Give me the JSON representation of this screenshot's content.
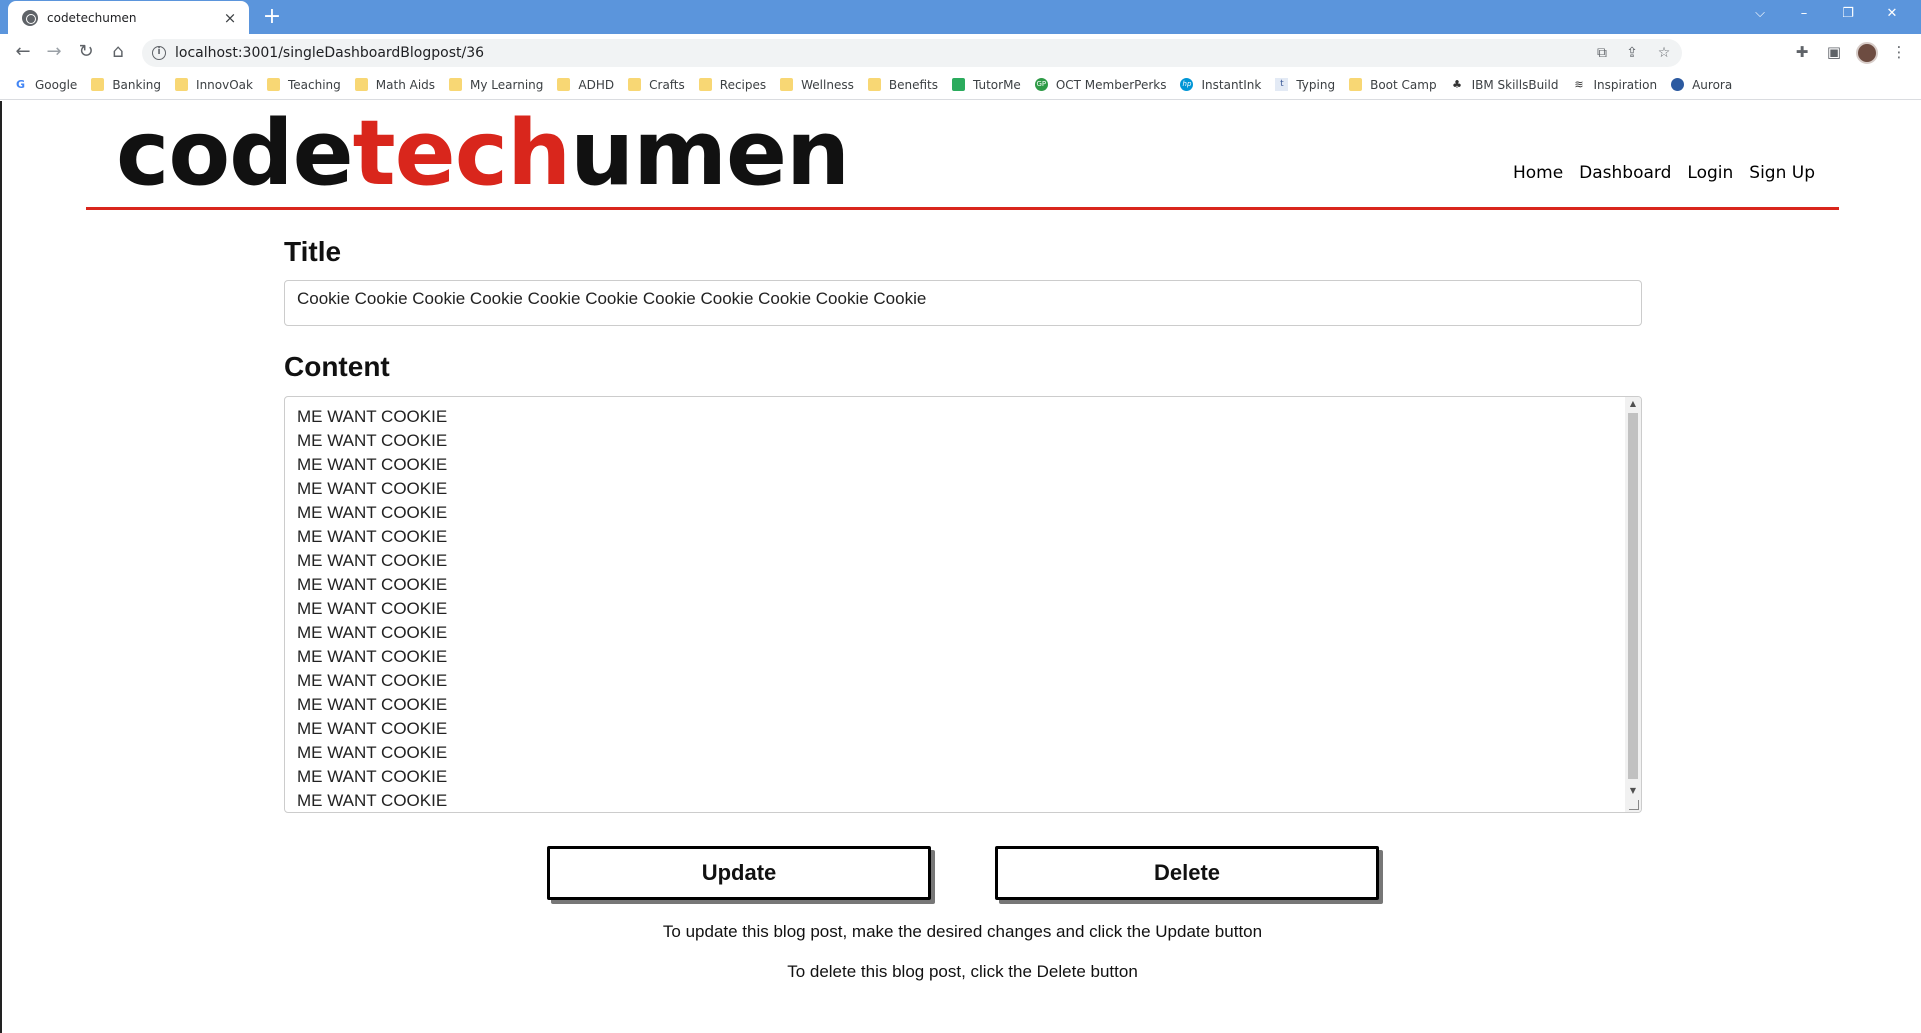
{
  "browser": {
    "tab_title": "codetechumen",
    "tab_close": "×",
    "new_tab": "+",
    "url": "localhost:3001/singleDashboardBlogpost/36",
    "window_controls": [
      "⌵",
      "–",
      "❐",
      "✕"
    ],
    "bookmarks": [
      {
        "label": "Google",
        "icon": "google-icon"
      },
      {
        "label": "Banking",
        "icon": "folder-icon"
      },
      {
        "label": "InnovOak",
        "icon": "folder-icon"
      },
      {
        "label": "Teaching",
        "icon": "folder-icon"
      },
      {
        "label": "Math Aids",
        "icon": "folder-icon"
      },
      {
        "label": "My Learning",
        "icon": "folder-icon"
      },
      {
        "label": "ADHD",
        "icon": "folder-icon"
      },
      {
        "label": "Crafts",
        "icon": "folder-icon"
      },
      {
        "label": "Recipes",
        "icon": "folder-icon"
      },
      {
        "label": "Wellness",
        "icon": "folder-icon"
      },
      {
        "label": "Benefits",
        "icon": "folder-icon"
      },
      {
        "label": "TutorMe",
        "icon": "tutorme-icon"
      },
      {
        "label": "OCT MemberPerks",
        "icon": "oct-icon"
      },
      {
        "label": "InstantInk",
        "icon": "hp-icon"
      },
      {
        "label": "Typing",
        "icon": "typing-icon"
      },
      {
        "label": "Boot Camp",
        "icon": "folder-icon"
      },
      {
        "label": "IBM SkillsBuild",
        "icon": "ibm-icon"
      },
      {
        "label": "Inspiration",
        "icon": "inspiration-icon"
      },
      {
        "label": "Aurora",
        "icon": "aurora-icon"
      }
    ]
  },
  "site": {
    "logo_part1": "code",
    "logo_part2": "tech",
    "logo_part3": "umen",
    "nav": [
      "Home",
      "Dashboard",
      "Login",
      "Sign Up"
    ]
  },
  "form": {
    "title_label": "Title",
    "title_value": "Cookie Cookie Cookie Cookie Cookie Cookie Cookie Cookie Cookie Cookie Cookie",
    "content_label": "Content",
    "content_lines": [
      "ME WANT COOKIE",
      "ME WANT COOKIE",
      "ME WANT COOKIE",
      "ME WANT COOKIE",
      "ME WANT COOKIE",
      "ME WANT COOKIE",
      "ME WANT COOKIE",
      "ME WANT COOKIE",
      "ME WANT COOKIE",
      "ME WANT COOKIE",
      "ME WANT COOKIE",
      "ME WANT COOKIE",
      "ME WANT COOKIE",
      "ME WANT COOKIE",
      "ME WANT COOKIE",
      "ME WANT COOKIE",
      "ME WANT COOKIE"
    ],
    "update_label": "Update",
    "delete_label": "Delete",
    "update_hint": "To update this blog post, make the desired changes and click the Update button",
    "delete_hint": "To delete this blog post, click the Delete button"
  },
  "colors": {
    "brand_red": "#d9261c",
    "chrome_blue": "#5b95dc"
  }
}
